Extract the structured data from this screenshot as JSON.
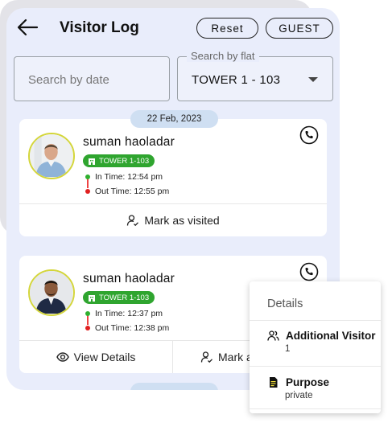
{
  "header": {
    "title": "Visitor Log",
    "reset_label": "Reset",
    "guest_label": "GUEST"
  },
  "filters": {
    "date_placeholder": "Search by date",
    "flat_legend": "Search by flat",
    "flat_value": "TOWER 1 - 103"
  },
  "date_chip": "22 Feb, 2023",
  "visitors": [
    {
      "name": "suman haoladar",
      "tower": "TOWER 1-103",
      "in_time": "In Time: 12:54 pm",
      "out_time": "Out Time: 12:55 pm",
      "action_label": "Mark as visited"
    },
    {
      "name": "suman haoladar",
      "tower": "TOWER 1-103",
      "in_time": "In Time: 12:37 pm",
      "out_time": "Out Time: 12:38 pm",
      "view_details_label": "View Details",
      "mark_label": "Mark a"
    }
  ],
  "popup": {
    "title": "Details",
    "items": [
      {
        "label": "Additional Visitor",
        "value": "1"
      },
      {
        "label": "Purpose",
        "value": "private"
      }
    ]
  },
  "colors": {
    "background": "#e9edfb",
    "badge_green": "#2fa52f",
    "in_dot": "#2fb02f",
    "out_dot": "#e02020",
    "avatar_ring": "#d4d63a",
    "date_chip": "#cfdff2"
  }
}
